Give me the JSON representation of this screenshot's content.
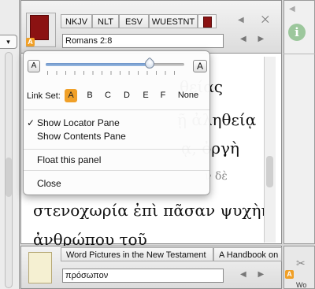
{
  "left_pane": {
    "dropdown_glyph": "▾"
  },
  "main": {
    "tabs": [
      "NKJV",
      "NLT",
      "ESV",
      "WUESTNT"
    ],
    "badge": "A",
    "reference": "Romans 2:8",
    "back_arrow": "◀",
    "close_glyph": "⨉",
    "nav_arrows": "◀ ▶",
    "greek_lines": [
      "θείας",
      "ῇ ἀληθείᾳ",
      "ᾳ, ὀργὴ",
      "ν δὲ",
      "στενοχωρία ἐπὶ πᾶσαν ψυχὴν",
      "ἀνθρώπου τοῦ"
    ]
  },
  "right_pane": {
    "info_glyph": "i",
    "back_arrow": "◀"
  },
  "bottom": {
    "tabs": [
      "Word Pictures in the New Testament",
      "A Handbook on"
    ],
    "search_value": "πρόσωπον",
    "nav_arrows": "◀ ▶",
    "badge": "A",
    "side_label": "Wo",
    "tools_glyph": "✂"
  },
  "popover": {
    "size_small": "A",
    "size_large": "A",
    "font_size_level": 0.73,
    "link_set_label": "Link Set:",
    "link_sets": [
      "A",
      "B",
      "C",
      "D",
      "E",
      "F",
      "None"
    ],
    "link_set_selected": "A",
    "check_glyph": "✓",
    "menu_items": [
      "Show Locator Pane",
      "Show Contents Pane",
      "Float this panel",
      "Close"
    ]
  },
  "colors": {
    "accent": "#f0a028",
    "book_red": "#8b1212",
    "info_green": "#9cc79c"
  }
}
